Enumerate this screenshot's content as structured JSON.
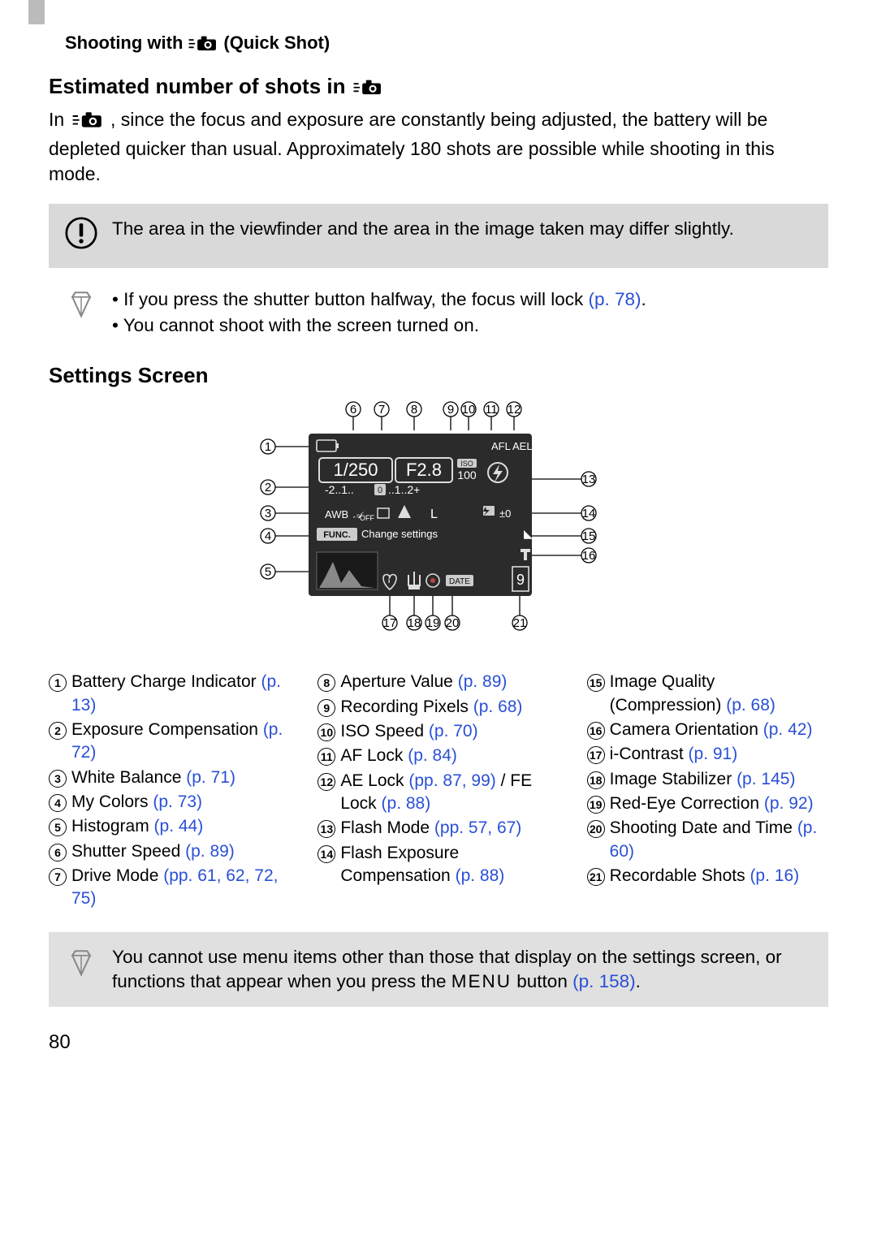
{
  "header": {
    "prefix": "Shooting with",
    "suffix": "(Quick Shot)"
  },
  "section1": {
    "title": "Estimated number of shots in",
    "text_prefix": "In ",
    "text_rest": ", since the focus and exposure are constantly being adjusted, the battery will be depleted quicker than usual. Approximately 180 shots are possible while shooting in this mode."
  },
  "warning": "The area in the viewfinder and the area in the image taken may differ slightly.",
  "tips": {
    "item1_a": "If you press the shutter button halfway, the focus will lock ",
    "item1_link": "(p. 78)",
    "item1_b": ".",
    "item2": "You cannot shoot with the screen turned on."
  },
  "section2": {
    "title": "Settings Screen"
  },
  "legend": [
    {
      "n": "1",
      "t": "Battery Charge Indicator ",
      "link": "(p. 13)"
    },
    {
      "n": "2",
      "t": "Exposure Compensation ",
      "link": "(p. 72)"
    },
    {
      "n": "3",
      "t": "White Balance ",
      "link": "(p. 71)"
    },
    {
      "n": "4",
      "t": "My Colors ",
      "link": "(p. 73)"
    },
    {
      "n": "5",
      "t": "Histogram ",
      "link": "(p. 44)"
    },
    {
      "n": "6",
      "t": "Shutter Speed ",
      "link": "(p. 89)"
    },
    {
      "n": "7",
      "t": "Drive Mode ",
      "link": "(pp. 61, 62, 72, 75)"
    },
    {
      "n": "8",
      "t": "Aperture Value ",
      "link": "(p. 89)"
    },
    {
      "n": "9",
      "t": "Recording Pixels ",
      "link": "(p. 68)"
    },
    {
      "n": "10",
      "t": "ISO Speed ",
      "link": "(p. 70)"
    },
    {
      "n": "11",
      "t": "AF Lock ",
      "link": "(p. 84)"
    },
    {
      "n": "12",
      "t1": "AE Lock ",
      "link1": "(pp. 87, 99)",
      "mid": " / FE Lock ",
      "link2": "(p. 88)"
    },
    {
      "n": "13",
      "t": "Flash Mode ",
      "link": "(pp. 57, 67)"
    },
    {
      "n": "14",
      "t": "Flash Exposure Compensation ",
      "link": "(p. 88)"
    },
    {
      "n": "15",
      "t": "Image Quality (Compression) ",
      "link": "(p. 68)"
    },
    {
      "n": "16",
      "t": "Camera Orientation ",
      "link": "(p. 42)"
    },
    {
      "n": "17",
      "t": "i-Contrast ",
      "link": "(p. 91)"
    },
    {
      "n": "18",
      "t": "Image Stabilizer ",
      "link": "(p. 145)"
    },
    {
      "n": "19",
      "t": "Red-Eye Correction ",
      "link": "(p. 92)"
    },
    {
      "n": "20",
      "t": "Shooting Date and Time ",
      "link": "(p. 60)"
    },
    {
      "n": "21",
      "t": "Recordable Shots ",
      "link": "(p. 16)"
    }
  ],
  "diagram": {
    "shutter": "1/250",
    "aperture": "F2.8",
    "iso_label": "ISO",
    "iso_val": "100",
    "afl": "AFL",
    "ael": "AEL",
    "ev_left": "-2..1..",
    "ev_mid": "0",
    "ev_right": "..1..2+",
    "wb": "AWB",
    "off": "OFF",
    "flash_comp": "±0",
    "func": "FUNC.",
    "func_text": "Change settings",
    "date": "DATE",
    "shots": "9"
  },
  "bottom_note": {
    "a": "You cannot use menu items other than those that display on the settings screen, or functions that appear when you press the ",
    "b_menu": "MENU",
    "c": " button ",
    "link": "(p. 158)",
    "d": "."
  },
  "page_number": "80"
}
